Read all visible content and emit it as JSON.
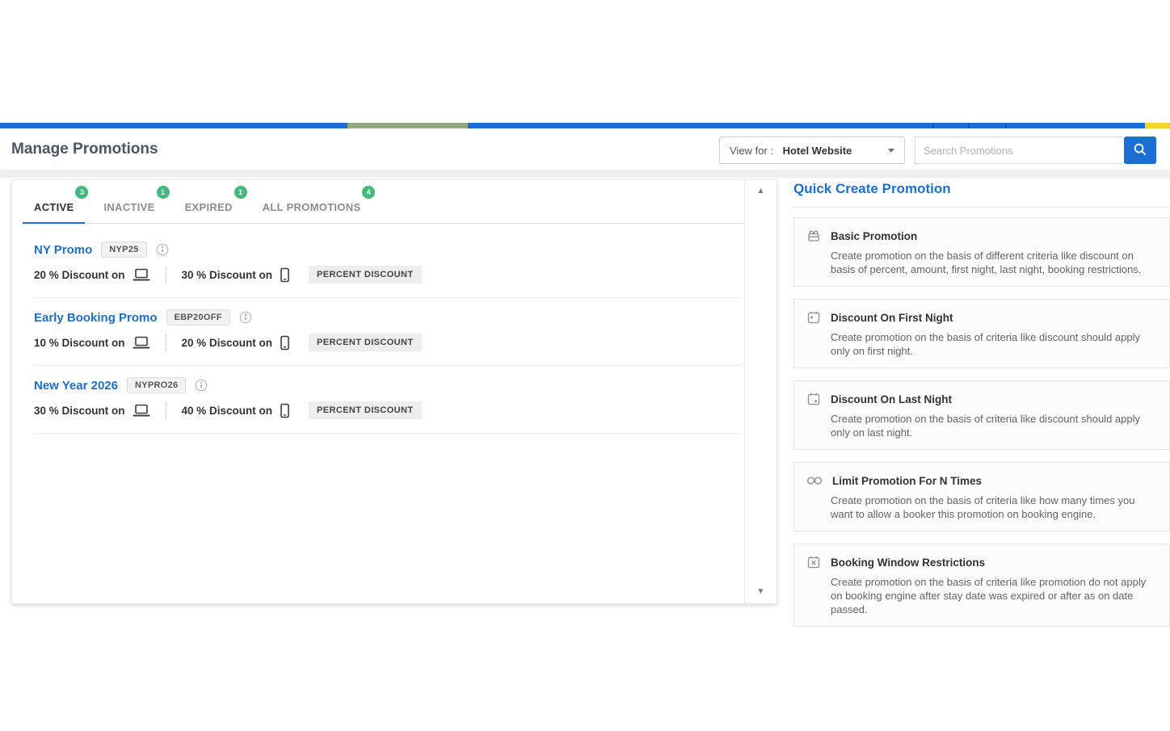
{
  "colors": {
    "accent_blue": "#1b6fd2",
    "link_blue": "#1b6fc9",
    "badge_green": "#43b97b",
    "bar_olive": "#93a87f",
    "bar_yellow": "#f6d32b"
  },
  "header": {
    "title": "Manage Promotions"
  },
  "controls": {
    "view_for_label": "View for : ",
    "view_for_value": "Hotel Website",
    "search_placeholder": "Search Promotions"
  },
  "tabs": [
    {
      "label": "ACTIVE",
      "count": "3",
      "active": true
    },
    {
      "label": "INACTIVE",
      "count": "1",
      "active": false
    },
    {
      "label": "EXPIRED",
      "count": "1",
      "active": false
    },
    {
      "label": "ALL PROMOTIONS",
      "count": "4",
      "active": false
    }
  ],
  "promotions": [
    {
      "name": "NY Promo",
      "code": "NYP25",
      "desktop_discount": "20 % Discount on",
      "mobile_discount": "30 % Discount on",
      "type": "PERCENT DISCOUNT"
    },
    {
      "name": "Early Booking Promo",
      "code": "EBP20OFF",
      "desktop_discount": "10 % Discount on",
      "mobile_discount": "20 % Discount on",
      "type": "PERCENT DISCOUNT"
    },
    {
      "name": "New Year 2026",
      "code": "NYPRO26",
      "desktop_discount": "30 % Discount on",
      "mobile_discount": "40 % Discount on",
      "type": "PERCENT DISCOUNT"
    }
  ],
  "quick_create": {
    "title": "Quick Create Promotion",
    "cards": [
      {
        "icon": "gift-icon",
        "title": "Basic Promotion",
        "description": "Create promotion on the basis of different criteria like discount on basis of percent, amount, first night, last night, booking restrictions."
      },
      {
        "icon": "calendar-first-night-icon",
        "title": "Discount On First Night",
        "description": "Create promotion on the basis of criteria like discount should apply only on first night."
      },
      {
        "icon": "calendar-last-night-icon",
        "title": "Discount On Last Night",
        "description": "Create promotion on the basis of criteria like discount should apply only on last night."
      },
      {
        "icon": "infinity-icon",
        "title": "Limit Promotion For N Times",
        "description": "Create promotion on the basis of criteria like how many times you want to allow a booker this promotion on booking engine."
      },
      {
        "icon": "calendar-restriction-icon",
        "title": "Booking Window Restrictions",
        "description": "Create promotion on the basis of criteria like promotion do not apply on booking engine after stay date was expired or after as on date passed."
      }
    ]
  }
}
